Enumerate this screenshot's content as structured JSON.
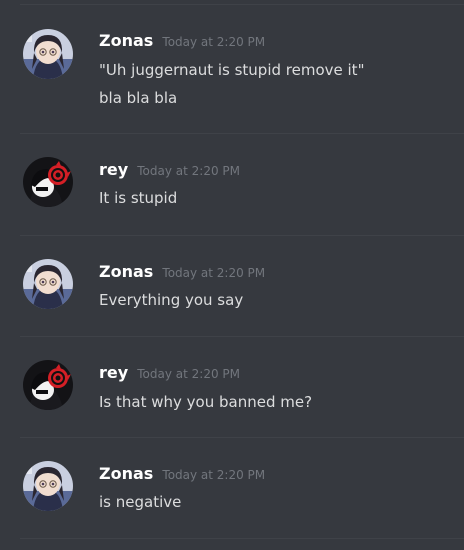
{
  "messages": [
    {
      "author": "Zonas",
      "avatar_icon": "zonas-avatar-icon",
      "timestamp": "Today at 2:20 PM",
      "lines": [
        "\"Uh juggernaut is stupid remove it\"",
        "bla bla bla"
      ]
    },
    {
      "author": "rey",
      "avatar_icon": "rey-avatar-icon",
      "timestamp": "Today at 2:20 PM",
      "lines": [
        "It is stupid"
      ]
    },
    {
      "author": "Zonas",
      "avatar_icon": "zonas-avatar-icon",
      "timestamp": "Today at 2:20 PM",
      "lines": [
        "Everything you say"
      ]
    },
    {
      "author": "rey",
      "avatar_icon": "rey-avatar-icon",
      "timestamp": "Today at 2:20 PM",
      "lines": [
        "Is that why you banned me?"
      ]
    },
    {
      "author": "Zonas",
      "avatar_icon": "zonas-avatar-icon",
      "timestamp": "Today at 2:20 PM",
      "lines": [
        "is negative"
      ]
    }
  ],
  "colors": {
    "background": "#36393f",
    "username": "#ffffff",
    "timestamp": "#72767d",
    "message_text": "#dcddde",
    "divider": "#3f4248"
  }
}
